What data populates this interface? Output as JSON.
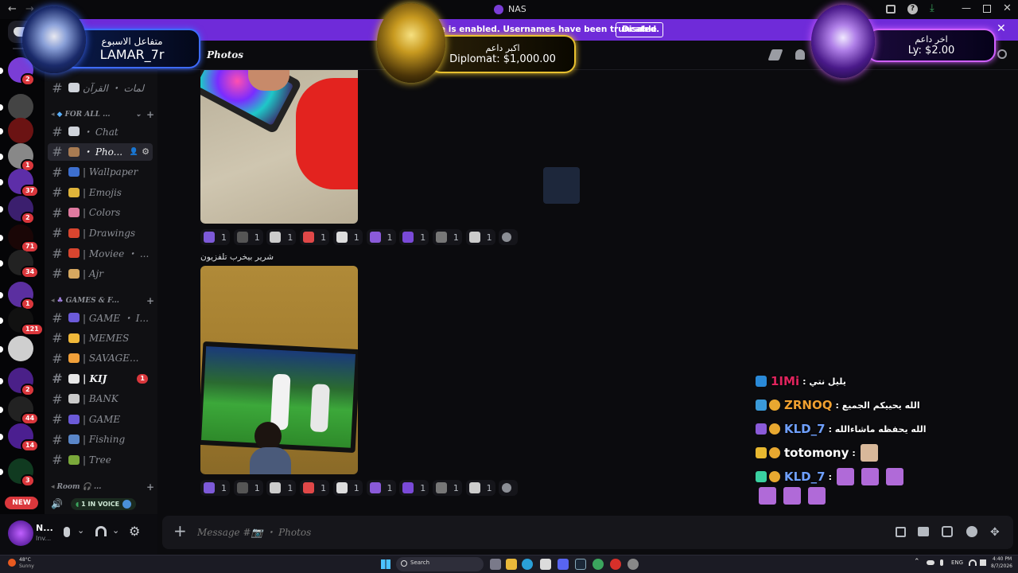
{
  "window": {
    "title": "NAS"
  },
  "banner": {
    "message": "e is enabled. Usernames have been truncated.",
    "disable_label": "Disable"
  },
  "servers": [
    {
      "badge": "2",
      "color": "#7a3dd6"
    },
    {
      "badge": "",
      "color": "#444"
    },
    {
      "badge": "",
      "color": "#6b1313"
    },
    {
      "badge": "1",
      "color": "#888"
    },
    {
      "badge": "37",
      "color": "#5d2ea8"
    },
    {
      "badge": "2",
      "color": "#3b1f6e"
    },
    {
      "badge": "71",
      "color": "#1a0606"
    },
    {
      "badge": "34",
      "color": "#222"
    },
    {
      "badge": "1",
      "color": "#5b2fa0"
    },
    {
      "badge": "121",
      "color": "#111"
    },
    {
      "badge": "",
      "color": "#cfcfcf"
    },
    {
      "badge": "2",
      "color": "#4a2088"
    },
    {
      "badge": "44",
      "color": "#222"
    },
    {
      "badge": "14",
      "color": "#4b1f90"
    },
    {
      "badge": "3",
      "color": "#103a20"
    }
  ],
  "new_badge": "NEW",
  "channels": {
    "top_item": "لمات ・ القرآن",
    "cat1": "FOR ALL ...",
    "cat1_items": [
      {
        "label": "・ Chat",
        "color": "#cfd3da"
      },
      {
        "label": "・ Pho...",
        "color": "#a87b52",
        "selected": true
      },
      {
        "label": "| Wallpaper",
        "color": "#3d6fcf"
      },
      {
        "label": "| Emojis",
        "color": "#e0b43a"
      },
      {
        "label": "| Colors",
        "color": "#e07aa0"
      },
      {
        "label": "| Drawings",
        "color": "#d8452f"
      },
      {
        "label": "| Moviee ・ ...",
        "color": "#d8452f"
      },
      {
        "label": "| Ajr",
        "color": "#d7a860"
      }
    ],
    "cat2": "GAMES & F...",
    "cat2_items": [
      {
        "label": "| GAME ・ I...",
        "color": "#6b5ad8"
      },
      {
        "label": "| MEMES",
        "color": "#f0b83a"
      },
      {
        "label": "| SAVAGE...",
        "color": "#f0a03a"
      },
      {
        "label": "| KIJ",
        "color": "#e7e7e7",
        "badge": "1"
      },
      {
        "label": "| BANK",
        "color": "#c9c9c9"
      },
      {
        "label": "| GAME",
        "color": "#6b5ad8"
      },
      {
        "label": "| Fishing",
        "color": "#5a86c8"
      },
      {
        "label": "| Tree",
        "color": "#7aa83a"
      }
    ],
    "cat3": "Room 🎧 ...",
    "voice_label": "1 IN VOICE"
  },
  "header": {
    "channel_name": "Photos"
  },
  "messages": [
    {
      "caption": ""
    },
    {
      "caption": "شرير بيخرب تلفزيون"
    }
  ],
  "reactions": [
    "1",
    "1",
    "1",
    "1",
    "1",
    "1",
    "1",
    "1",
    "1"
  ],
  "reaction_colors": [
    "#7d5ad8",
    "#555",
    "#ccc",
    "#e04848",
    "#ddd",
    "#8a5ad8",
    "#7a4ad8",
    "#777",
    "#ccc"
  ],
  "overlays": {
    "weekly": {
      "title": "متفاعل الاسبوع",
      "name": "LAMAR_7r"
    },
    "top": {
      "title": "اكبر داعم",
      "value": "Diplomat: $1,000.00"
    },
    "last": {
      "title": "اخر داعم",
      "value": "Ly: $2.00"
    }
  },
  "live_chat": [
    {
      "user": "1IMi",
      "user_color": "#e0245e",
      "text": "يليل نتي :"
    },
    {
      "user": "ZRNOQ",
      "user_color": "#f0a030",
      "text": "الله يحييكم الجميع :"
    },
    {
      "user": "KLD_7",
      "user_color": "#6fa0ff",
      "text": "الله يحفظه ماشاءالله :"
    },
    {
      "user": "totomony",
      "user_color": "#ffffff",
      "text": ":"
    },
    {
      "user": "KLD_7",
      "user_color": "#6fa0ff",
      "text": ":"
    }
  ],
  "user_panel": {
    "name": "N...",
    "status": "Inv..."
  },
  "composer": {
    "placeholder": "Message #📷 ・ Photos"
  },
  "taskbar": {
    "temp": "48°C",
    "weather": "Sunny",
    "search": "Search",
    "lang": "ENG",
    "time": "4:40 PM",
    "date": "8/7/2026"
  },
  "colors": {
    "banner": "#6f2bd9",
    "accent": "#5865f2",
    "badge": "#da373c",
    "gold": "#e8c030",
    "blue_glow": "#3e6bff"
  }
}
